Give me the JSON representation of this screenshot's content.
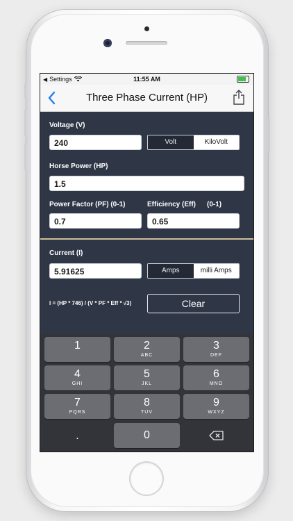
{
  "status_bar": {
    "back_app": "Settings",
    "time": "11:55 AM"
  },
  "nav": {
    "title": "Three Phase Current (HP)"
  },
  "voltage": {
    "label": "Voltage (V)",
    "value": "240",
    "units": [
      {
        "label": "Volt",
        "selected": false
      },
      {
        "label": "KiloVolt",
        "selected": true
      }
    ]
  },
  "horse_power": {
    "label": "Horse Power (HP)",
    "value": "1.5"
  },
  "power_factor": {
    "label": "Power Factor (PF) (0-1)",
    "value": "0.7"
  },
  "efficiency": {
    "label": "Efficiency (Eff)",
    "range": "(0-1)",
    "value": "0.65"
  },
  "current": {
    "label": "Current (I)",
    "value": "5.91625",
    "units": [
      {
        "label": "Amps",
        "selected": false
      },
      {
        "label": "milli Amps",
        "selected": true
      }
    ]
  },
  "formula": "I = (HP * 746) / (V * PF * Eff * √3)",
  "clear_label": "Clear",
  "keypad": {
    "keys": [
      {
        "num": "1",
        "sub": ""
      },
      {
        "num": "2",
        "sub": "ABC"
      },
      {
        "num": "3",
        "sub": "DEF"
      },
      {
        "num": "4",
        "sub": "GHI"
      },
      {
        "num": "5",
        "sub": "JKL"
      },
      {
        "num": "6",
        "sub": "MNO"
      },
      {
        "num": "7",
        "sub": "PQRS"
      },
      {
        "num": "8",
        "sub": "TUV"
      },
      {
        "num": "9",
        "sub": "WXYZ"
      },
      {
        "num": ".",
        "sub": ""
      },
      {
        "num": "0",
        "sub": ""
      }
    ]
  },
  "icons": {
    "back": "chevron-left-icon",
    "share": "share-icon",
    "wifi": "wifi-icon",
    "battery": "battery-icon",
    "delete": "backspace-icon"
  },
  "colors": {
    "background": "#2f3747",
    "accent": "#1f7cf5",
    "divider": "#cdbf9a",
    "keypad": "#32343a"
  }
}
